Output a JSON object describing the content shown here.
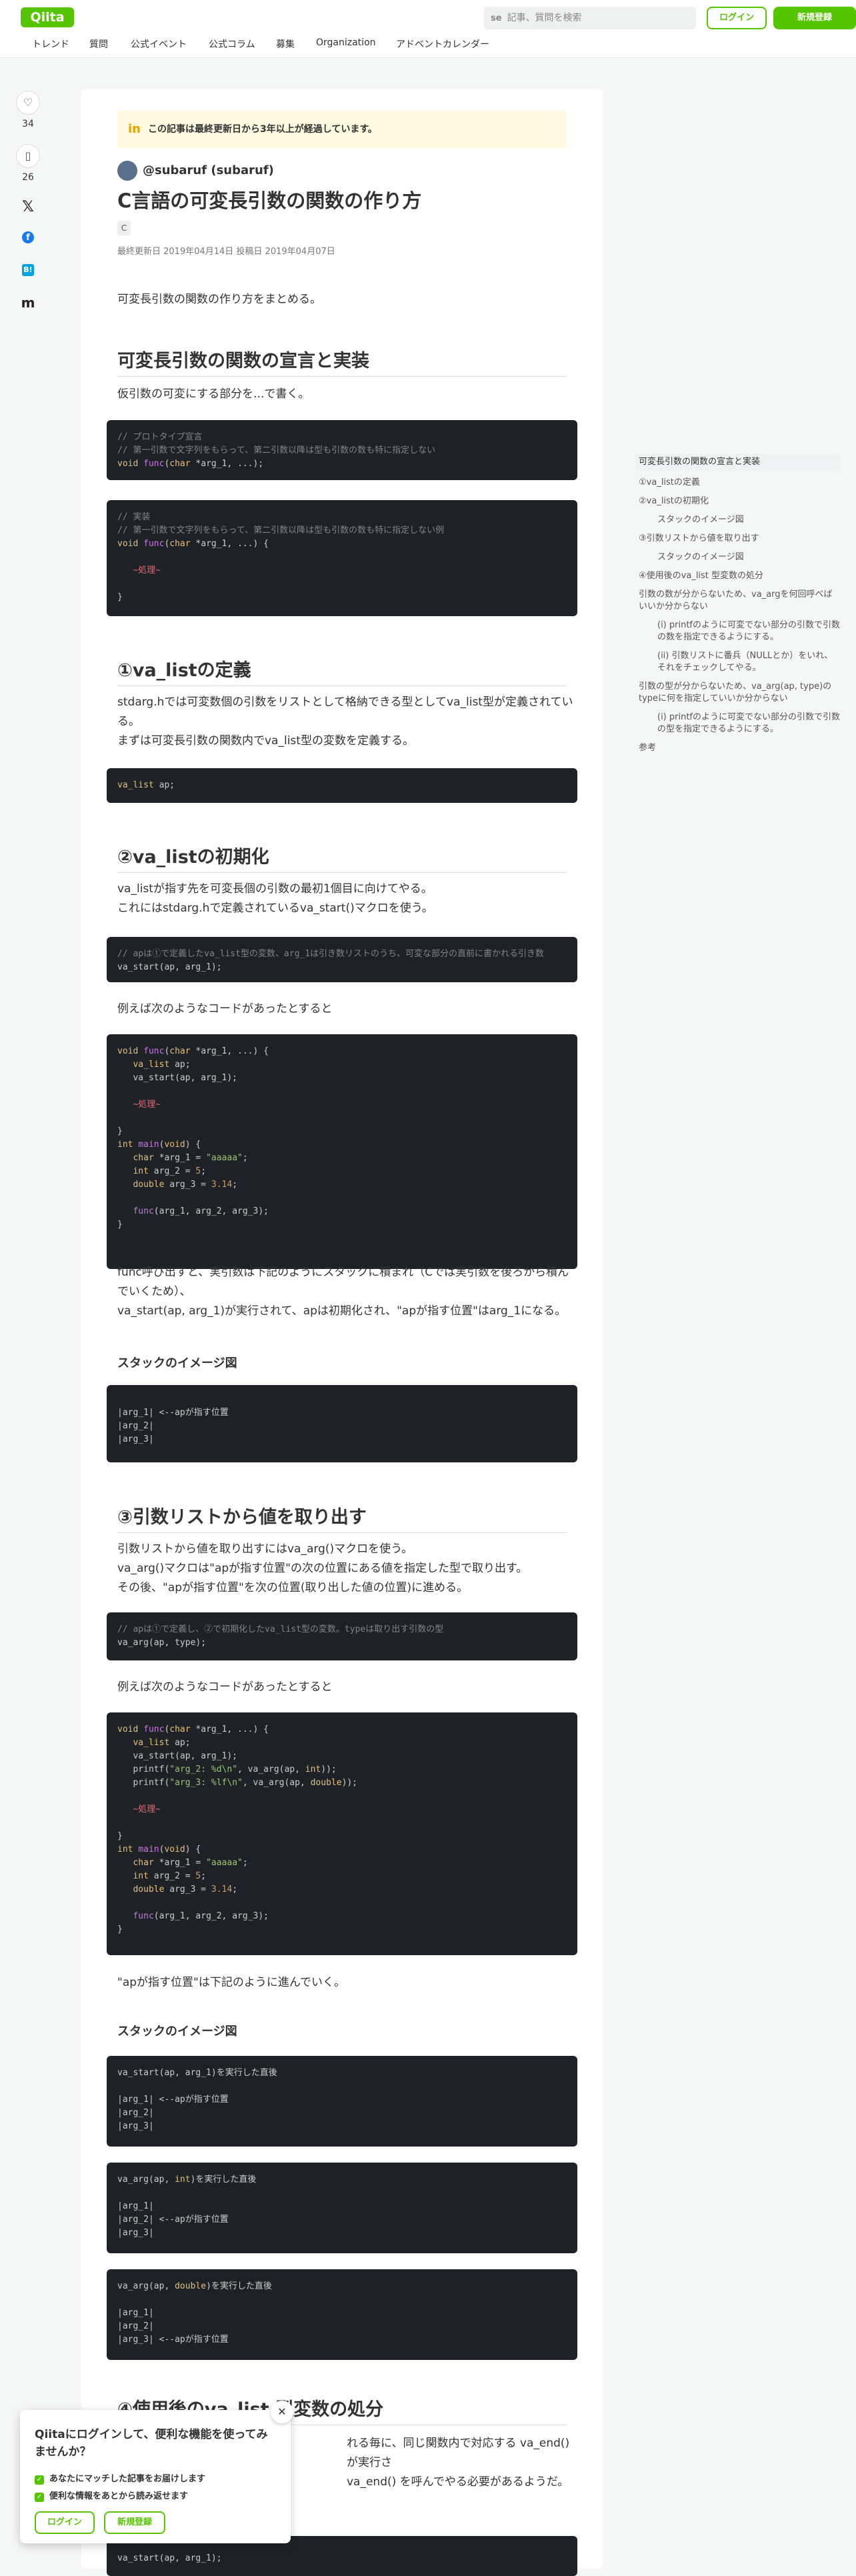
{
  "header": {
    "logo": "Qiita",
    "search_placeholder": "記事、質問を検索",
    "login": "ログイン",
    "signup": "新規登録",
    "nav": [
      "トレンド",
      "質問",
      "公式イベント",
      "公式コラム",
      "募集",
      "Organization",
      "アドベントカレンダー"
    ]
  },
  "actions": {
    "likes": "34",
    "stocks": "26"
  },
  "article": {
    "notice": "この記事は最終更新日から3年以上が経過しています。",
    "author": "@subaruf (subaruf)",
    "title": "C言語の可変長引数の関数の作り方",
    "tag": "C",
    "dates": "最終更新日 2019年04月14日  投稿日 2019年04月07日",
    "intro": "可変長引数の関数の作り方をまとめる。",
    "h_decl": "可変長引数の関数の宣言と実装",
    "p_decl": "仮引数の可変にする部分を...で書く。",
    "code1": [
      "// プロトタイプ宣言",
      "// 第一引数で文字列をもらって、第二引数以降は型も引数の数も特に指定しない",
      "void func(char *arg_1, ...);"
    ],
    "code2": [
      "// 実装",
      "// 第一引数で文字列をもらって、第二引数以降は型も引数の数も特に指定しない例",
      "void func(char *arg_1, ...) {",
      "",
      "   ~処理~",
      "",
      "}"
    ],
    "h_valist": "①va_listの定義",
    "p_valist_1": "stdarg.hでは可変数個の引数をリストとして格納できる型としてva_list型が定義されている。",
    "p_valist_2": "まずは可変長引数の関数内でva_list型の変数を定義する。",
    "code3": [
      "va_list ap;"
    ],
    "h_init": "②va_listの初期化",
    "p_init_1": "va_listが指す先を可変長個の引数の最初1個目に向けてやる。",
    "p_init_2": "これにはstdarg.hで定義されているva_start()マクロを使う。",
    "code4": [
      "// apは①で定義したva_list型の変数、arg_1は引き数リストのうち、可変な部分の直前に書かれる引き数",
      "va_start(ap, arg_1);"
    ],
    "p_example_1": "例えば次のようなコードがあったとすると",
    "code5": [
      "void func(char *arg_1, ...) {",
      "   va_list ap;",
      "   va_start(ap, arg_1);",
      "",
      "   ~処理~",
      "",
      "}",
      "int main(void) {",
      "   char *arg_1 = \"aaaaa\";",
      "   int arg_2 = 5;",
      "   double arg_3 = 3.14;",
      "",
      "   func(arg_1, arg_2, arg_3);",
      "}"
    ],
    "p_call_1": "func呼び出すと、実引数は下記のようにスタックに積まれ（Cでは実引数を後ろから積んでいくため）、",
    "p_call_2": "va_start(ap, arg_1)が実行されて、apは初期化され、\"apが指す位置\"はarg_1になる。",
    "h3_stack": "スタックのイメージ図",
    "code6": [
      "|arg_1| <--apが指す位置",
      "|arg_2|",
      "|arg_3|"
    ],
    "h_get": "③引数リストから値を取り出す",
    "p_get_1": "引数リストから値を取り出すにはva_arg()マクロを使う。",
    "p_get_2": "va_arg()マクロは\"apが指す位置\"の次の位置にある値を指定した型で取り出す。",
    "p_get_3": "その後、\"apが指す位置\"を次の位置(取り出した値の位置)に進める。",
    "code7": [
      "// apは①で定義し、②で初期化したva_list型の変数。typeは取り出す引数の型",
      "va_arg(ap, type);"
    ],
    "p_example_2": "例えば次のようなコードがあったとすると",
    "code8": [
      "void func(char *arg_1, ...) {",
      "   va_list ap;",
      "   va_start(ap, arg_1);",
      "   printf(\"arg_2: %d\\n\", va_arg(ap, int));",
      "   printf(\"arg_3: %lf\\n\", va_arg(ap, double));",
      "",
      "   ~処理~",
      "",
      "}",
      "int main(void) {",
      "   char *arg_1 = \"aaaaa\";",
      "   int arg_2 = 5;",
      "   double arg_3 = 3.14;",
      "",
      "   func(arg_1, arg_2, arg_3);",
      "}"
    ],
    "p_ap_moves": "\"apが指す位置\"は下記のように進んでいく。",
    "h3_stack_2": "スタックのイメージ図",
    "code9": [
      "va_start(ap, arg_1)を実行した直後",
      "",
      "|arg_1| <--apが指す位置",
      "|arg_2|",
      "|arg_3|"
    ],
    "code10": [
      "va_arg(ap, int)を実行した直後",
      "",
      "|arg_1|",
      "|arg_2| <--apが指す位置",
      "|arg_3|"
    ],
    "code11": [
      "va_arg(ap, double)を実行した直後",
      "",
      "|arg_1|",
      "|arg_2|",
      "|arg_3| <--apが指す位置"
    ],
    "h_end": "④使用後のva_list 型変数の処分",
    "p_end_1": "れる毎に、同じ関数内で対応する va_end() が実行さ",
    "p_end_2": "va_end() を呼んでやる必要があるようだ。",
    "code12": [
      "va_start(ap, arg_1);"
    ]
  },
  "toc": [
    {
      "label": "可変長引数の関数の宣言と実装",
      "level": 1,
      "active": true
    },
    {
      "label": "①va_listの定義",
      "level": 1
    },
    {
      "label": "②va_listの初期化",
      "level": 1
    },
    {
      "label": "スタックのイメージ図",
      "level": 2
    },
    {
      "label": "③引数リストから値を取り出す",
      "level": 1
    },
    {
      "label": "スタックのイメージ図",
      "level": 2
    },
    {
      "label": "④使用後のva_list 型変数の処分",
      "level": 1
    },
    {
      "label": "引数の数が分からないため、va_argを何回呼べばいいか分からない",
      "level": 1
    },
    {
      "label": "(i) printfのように可変でない部分の引数で引数の数を指定できるようにする。",
      "level": 2
    },
    {
      "label": "(ii) 引数リストに番兵（NULLとか）をいれ、それをチェックしてやる。",
      "level": 2
    },
    {
      "label": "引数の型が分からないため、va_arg(ap, type)のtypeに何を指定していいか分からない",
      "level": 1
    },
    {
      "label": "(i) printfのように可変でない部分の引数で引数の型を指定できるようにする。",
      "level": 2
    },
    {
      "label": "参考",
      "level": 1
    }
  ],
  "popup": {
    "title": "Qiitaにログインして、便利な機能を使ってみませんか？",
    "benefit_1": "あなたにマッチした記事をお届けします",
    "benefit_2": "便利な情報をあとから読み返せます",
    "login": "ログイン",
    "signup": "新規登録"
  }
}
